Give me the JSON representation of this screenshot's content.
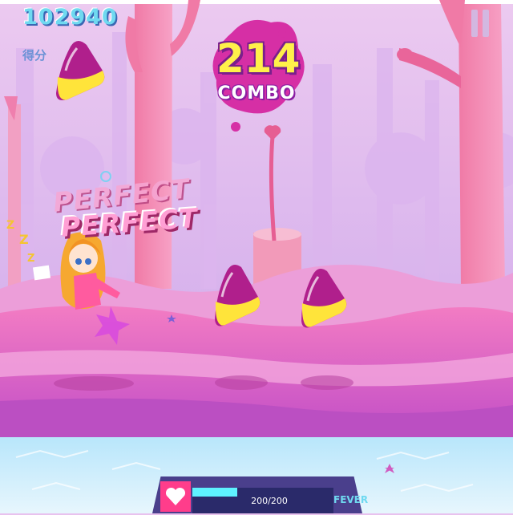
{
  "hud": {
    "score": "102940",
    "score_label": "得分",
    "pause_icon": "pause-icon"
  },
  "combo": {
    "count": "214",
    "label": "COMBO"
  },
  "judgement": {
    "trail": "PERFECT",
    "current": "PERFECT"
  },
  "fever": {
    "value_text": "200/200",
    "label": "FEVER",
    "level": 0.32,
    "icon": "heart-icon"
  },
  "colors": {
    "score": "#6fd9f0",
    "combo_number": "#fff04a",
    "combo_blob": "#d62fa5",
    "note_pink": "#b01f8c",
    "note_yellow": "#ffe43a",
    "ground": "#d77fd3",
    "water": "#cfeefd",
    "fever_fill": "#5ef2ff"
  }
}
